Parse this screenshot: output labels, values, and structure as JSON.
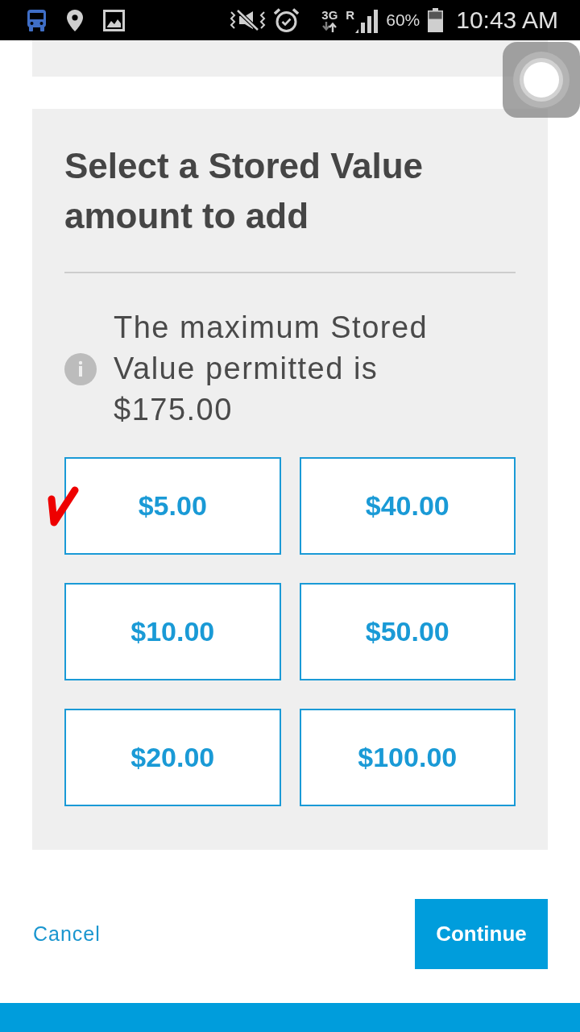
{
  "status_bar": {
    "network_type": "3G",
    "roaming": "R",
    "battery": "60%",
    "time": "10:43 AM"
  },
  "amount_panel": {
    "title": "Select a Stored Value amount to add",
    "info": "The maximum Stored Value permitted is $175.00",
    "amounts": [
      {
        "label": "$5.00",
        "selected": true
      },
      {
        "label": "$40.00",
        "selected": false
      },
      {
        "label": "$10.00",
        "selected": false
      },
      {
        "label": "$50.00",
        "selected": false
      },
      {
        "label": "$20.00",
        "selected": false
      },
      {
        "label": "$100.00",
        "selected": false
      }
    ]
  },
  "actions": {
    "cancel": "Cancel",
    "continue": "Continue"
  }
}
